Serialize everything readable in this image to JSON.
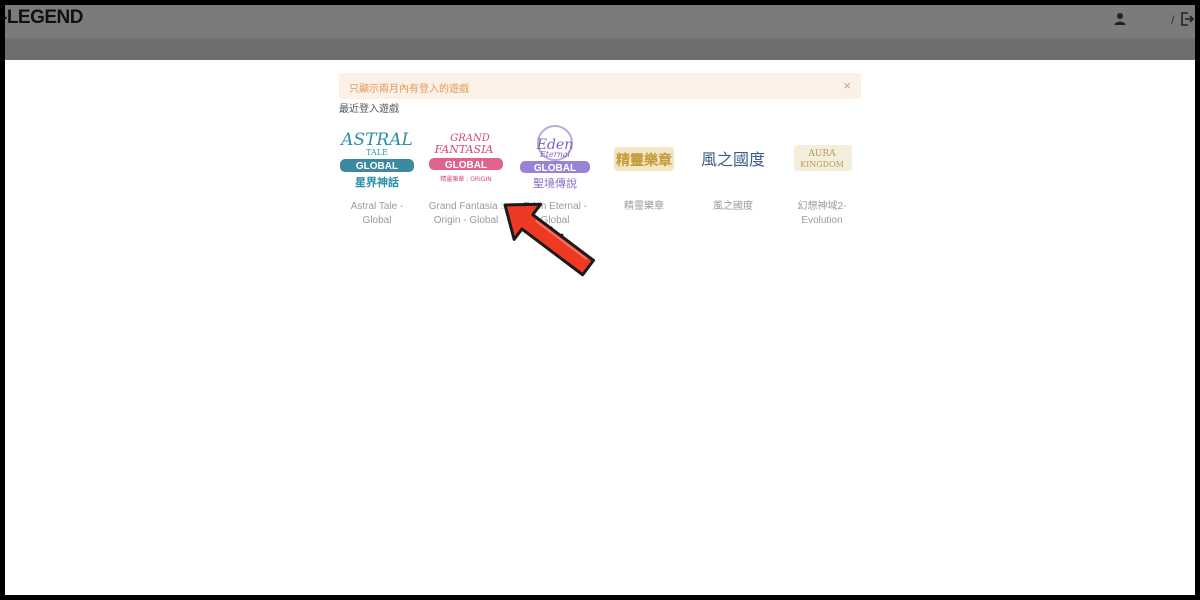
{
  "header": {
    "logo_text": "-LEGEND",
    "separator": "/",
    "user_icon": "user-icon",
    "logout_icon": "logout-icon"
  },
  "banner": {
    "text": "只顯示兩月內有登入的遊戲",
    "close_label": "×"
  },
  "section_title": "最近登入遊戲",
  "games": [
    {
      "logo_line1": "ASTRAL",
      "logo_line2": "TALE",
      "logo_badge": "GLOBAL",
      "logo_sub": "星界神話",
      "name_line1": "Astral Tale -",
      "name_line2": "Global",
      "color": "#2a9bb0"
    },
    {
      "logo_line1": "GRAND",
      "logo_line2": "FANTASIA",
      "logo_badge": "GLOBAL",
      "logo_sub": "精靈樂章 : ORIGIN",
      "name_line1": "Grand Fantasia :",
      "name_line2": "Origin - Global",
      "color": "#e05a8a"
    },
    {
      "logo_line1": "Eden",
      "logo_line2": "Eternal",
      "logo_badge": "GLOBAL",
      "logo_sub": "聖境傳說",
      "name_line1": "Eden Eternal -",
      "name_line2": "Global",
      "color": "#8a6cc8"
    },
    {
      "logo_line1": "精靈樂章",
      "logo_line2": "",
      "logo_badge": "",
      "logo_sub": "",
      "name_line1": "精靈樂章",
      "name_line2": "",
      "color": "#c99a3a"
    },
    {
      "logo_line1": "風之國度",
      "logo_line2": "",
      "logo_badge": "",
      "logo_sub": "",
      "name_line1": "風之國度",
      "name_line2": "",
      "color": "#3a6a9a"
    },
    {
      "logo_line1": "AURA",
      "logo_line2": "KINGDOM",
      "logo_badge": "",
      "logo_sub": "",
      "name_line1": "幻想神域2-",
      "name_line2": "Evolution",
      "color": "#c8b48a"
    }
  ]
}
